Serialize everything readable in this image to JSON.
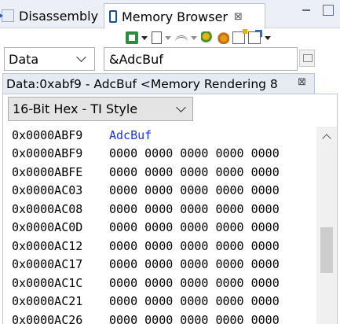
{
  "tabs": {
    "disassembly": "Disassembly",
    "memory_browser": "Memory Browser",
    "close_glyph": "⊠"
  },
  "controls": {
    "space_selected": "Data",
    "address_expression": "&AdcBuf"
  },
  "rendering": {
    "tab_title": "Data:0xabf9 - AdcBuf <Memory Rendering 8",
    "format_selected": "16-Bit Hex - TI Style"
  },
  "memory": {
    "label_row": {
      "address": "0x0000ABF9",
      "label": "AdcBuf"
    },
    "rows": [
      {
        "address": "0x0000ABF9",
        "values": "0000 0000 0000 0000 0000"
      },
      {
        "address": "0x0000ABFE",
        "values": "0000 0000 0000 0000 0000"
      },
      {
        "address": "0x0000AC03",
        "values": "0000 0000 0000 0000 0000"
      },
      {
        "address": "0x0000AC08",
        "values": "0000 0000 0000 0000 0000"
      },
      {
        "address": "0x0000AC0D",
        "values": "0000 0000 0000 0000 0000"
      },
      {
        "address": "0x0000AC12",
        "values": "0000 0000 0000 0000 0000"
      },
      {
        "address": "0x0000AC17",
        "values": "0000 0000 0000 0000 0000"
      },
      {
        "address": "0x0000AC1C",
        "values": "0000 0000 0000 0000 0000"
      },
      {
        "address": "0x0000AC21",
        "values": "0000 0000 0000 0000 0000"
      },
      {
        "address": "0x0000AC26",
        "values": "0000 0000 0000 0000 0000"
      }
    ]
  },
  "colors": {
    "label_blue": "#1d36d9",
    "tab_bg": "#ecf0f6"
  }
}
